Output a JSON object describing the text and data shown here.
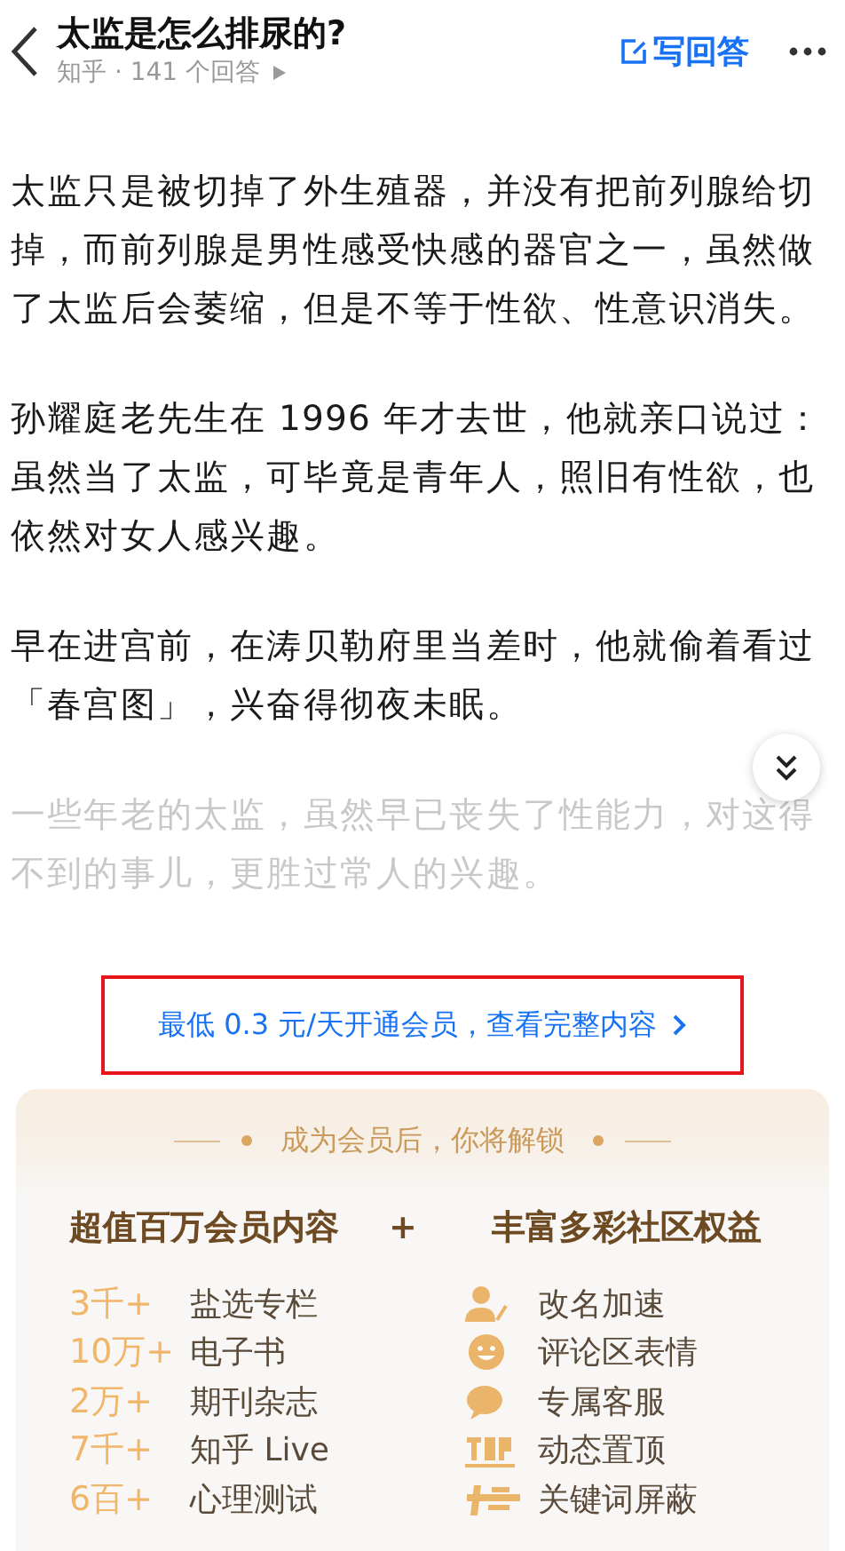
{
  "header": {
    "title": "太监是怎么排尿的?",
    "meta": "知乎 · 141 个回答",
    "write_answer": "写回答"
  },
  "paragraphs": [
    {
      "text": "太监只是被切掉了外生殖器，并没有把前列腺给切掉，而前列腺是男性感受快感的器官之一，虽然做了太监后会萎缩，但是不等于性欲、性意识消失。",
      "faded": false
    },
    {
      "text": "孙耀庭老先生在 1996 年才去世，他就亲口说过：虽然当了太监，可毕竟是青年人，照旧有性欲，也依然对女人感兴趣。",
      "faded": false
    },
    {
      "text": "早在进宫前，在涛贝勒府里当差时，他就偷着看过「春宫图」，兴奋得彻夜未眠。",
      "faded": false
    },
    {
      "text": "一些年老的太监，虽然早已丧失了性能力，对这得不到的事儿，更胜过常人的兴趣。",
      "faded": true
    }
  ],
  "paywall_link": {
    "text": "最低 0.3 元/天开通会员，查看完整内容",
    "highlighted": true
  },
  "perks": {
    "heading": "成为会员后，你将解锁",
    "left_title": "超值百万会员内容",
    "plus": "+",
    "right_title": "丰富多彩社区权益",
    "content": [
      {
        "count": "3千+",
        "name": "盐选专栏"
      },
      {
        "count": "10万+",
        "name": "电子书"
      },
      {
        "count": "2万+",
        "name": "期刊杂志"
      },
      {
        "count": "7千+",
        "name": "知乎 Live"
      },
      {
        "count": "6百+",
        "name": "心理测试"
      }
    ],
    "rights": [
      {
        "kind": "rename",
        "name": "改名加速"
      },
      {
        "kind": "emoji",
        "name": "评论区表情"
      },
      {
        "kind": "service",
        "name": "专属客服"
      },
      {
        "kind": "pin",
        "name": "动态置顶"
      },
      {
        "kind": "block",
        "name": "关键词屏蔽"
      }
    ]
  }
}
